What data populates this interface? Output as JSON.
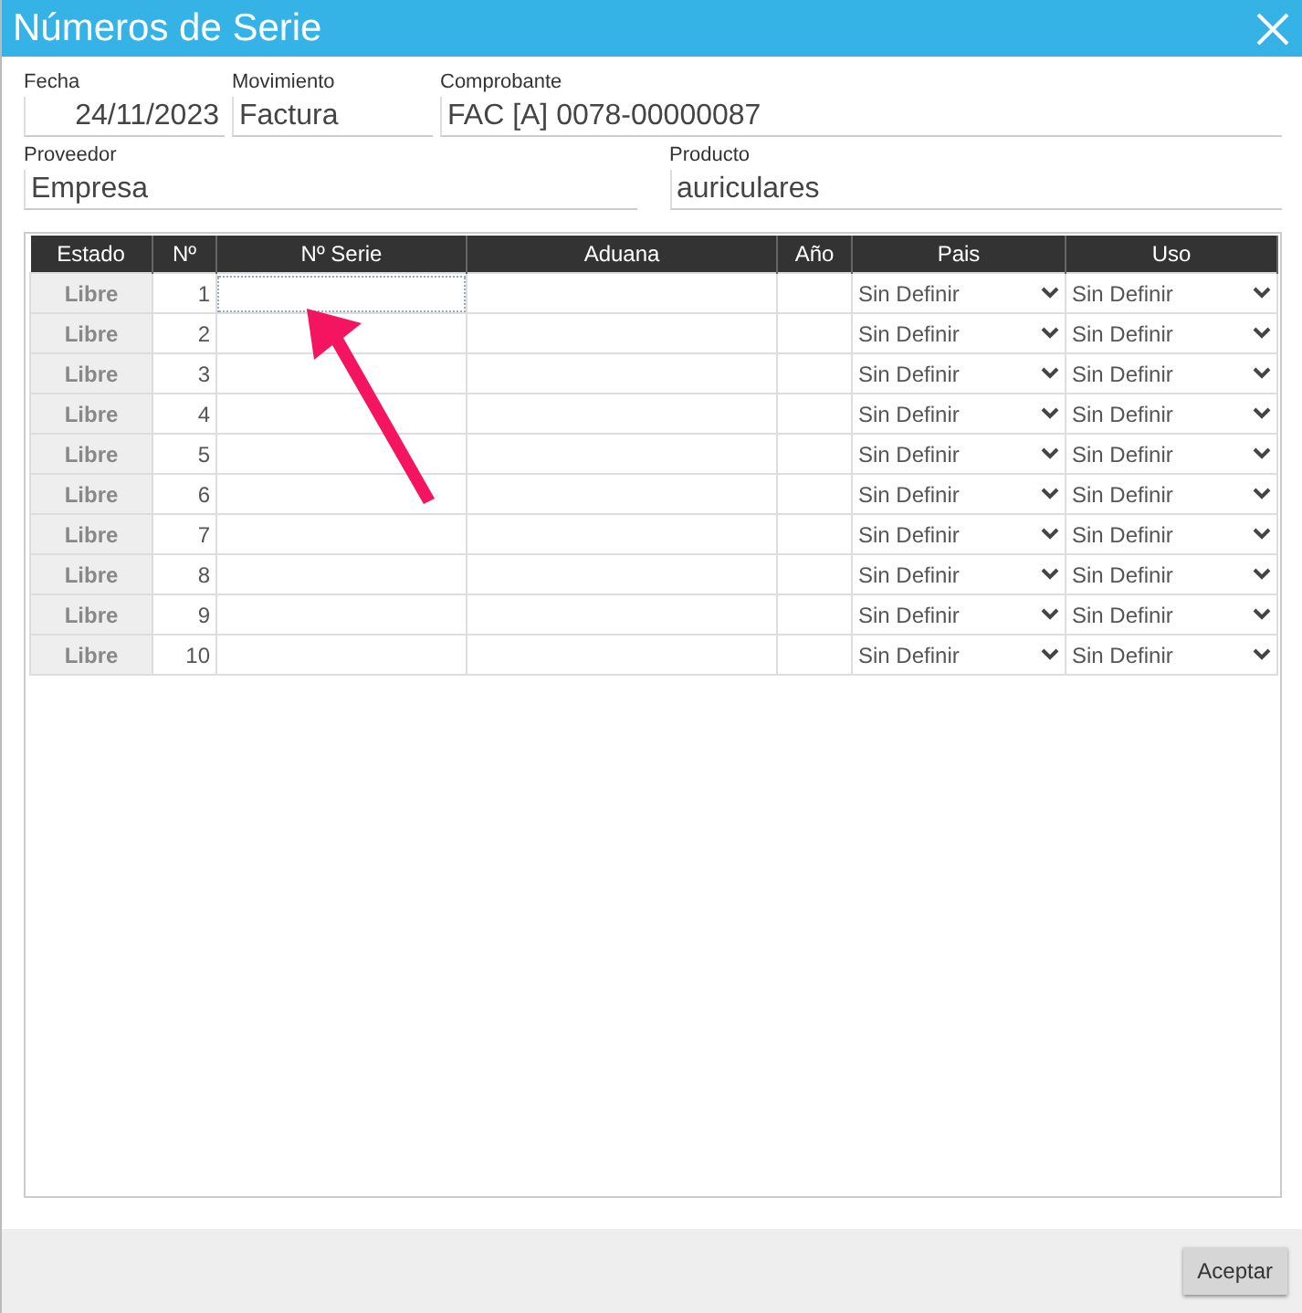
{
  "window": {
    "title": "Números de Serie"
  },
  "fields_row_1": [
    {
      "label": "Fecha",
      "value": "24/11/2023",
      "right_aligned": true
    },
    {
      "label": "Movimiento",
      "value": "Factura",
      "right_aligned": false
    },
    {
      "label": "Comprobante",
      "value": "FAC [A] 0078-00000087",
      "right_aligned": false
    }
  ],
  "fields_row_2": [
    {
      "label": "Proveedor",
      "value": "Empresa"
    },
    {
      "label": "Producto",
      "value": "auriculares"
    }
  ],
  "table": {
    "columns": [
      "Estado",
      "Nº",
      "Nº Serie",
      "Aduana",
      "Año",
      "Pais",
      "Uso"
    ],
    "rows": [
      {
        "estado": "Libre",
        "numero": "1",
        "focused": true,
        "pais": "Sin Definir",
        "uso": "Sin Definir"
      },
      {
        "estado": "Libre",
        "numero": "2",
        "focused": false,
        "pais": "Sin Definir",
        "uso": "Sin Definir"
      },
      {
        "estado": "Libre",
        "numero": "3",
        "focused": false,
        "pais": "Sin Definir",
        "uso": "Sin Definir"
      },
      {
        "estado": "Libre",
        "numero": "4",
        "focused": false,
        "pais": "Sin Definir",
        "uso": "Sin Definir"
      },
      {
        "estado": "Libre",
        "numero": "5",
        "focused": false,
        "pais": "Sin Definir",
        "uso": "Sin Definir"
      },
      {
        "estado": "Libre",
        "numero": "6",
        "focused": false,
        "pais": "Sin Definir",
        "uso": "Sin Definir"
      },
      {
        "estado": "Libre",
        "numero": "7",
        "focused": false,
        "pais": "Sin Definir",
        "uso": "Sin Definir"
      },
      {
        "estado": "Libre",
        "numero": "8",
        "focused": false,
        "pais": "Sin Definir",
        "uso": "Sin Definir"
      },
      {
        "estado": "Libre",
        "numero": "9",
        "focused": false,
        "pais": "Sin Definir",
        "uso": "Sin Definir"
      },
      {
        "estado": "Libre",
        "numero": "10",
        "focused": false,
        "pais": "Sin Definir",
        "uso": "Sin Definir"
      }
    ]
  },
  "buttons": [
    "Aceptar"
  ]
}
